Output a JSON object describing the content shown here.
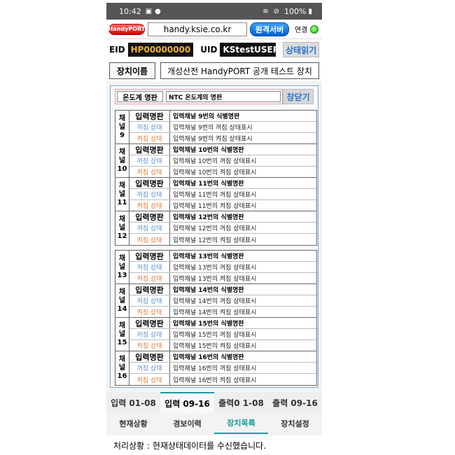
{
  "status_bar": {
    "time": "10:42",
    "battery": "100%",
    "icons": [
      "gallery-icon",
      "location-icon",
      "wifi-icon",
      "do-not-disturb-icon",
      "battery-icon"
    ]
  },
  "appbar": {
    "logo": "HandyPORT",
    "url": "handy.ksie.co.kr",
    "remote_label": "원격서버",
    "connection_label": "연결",
    "connection_color": "#1fb51f"
  },
  "ids": {
    "eid_label": "EID",
    "eid_value": "HP00000000",
    "uid_label": "UID",
    "uid_value": "KStestUSER",
    "read_button": "상태읽기"
  },
  "device": {
    "label": "장치이름",
    "name": "개성산전 HandyPORT 공개 테스트 장치"
  },
  "thermometer": {
    "label": "온도계 명판",
    "value": "NTC 온도계의 명판",
    "close_button": "창닫기"
  },
  "row_labels": {
    "head": "입력명판",
    "off": "꺼짐 상태",
    "on": "켜짐 상태"
  },
  "channels": [
    {
      "c1": "채",
      "c2": "널",
      "num": "9",
      "name": "입력채널 9번의 식별명판",
      "off": "입력채널 9번의 꺼짐 상태표시",
      "on": "입력채널 9번의 켜짐 상태표시"
    },
    {
      "c1": "채",
      "c2": "널",
      "num": "10",
      "name": "입력채널 10번의 식별명판",
      "off": "입력채널 10번의 꺼짐 상태표시",
      "on": "입력채널 10번의 켜짐 상태표시"
    },
    {
      "c1": "채",
      "c2": "널",
      "num": "11",
      "name": "입력채널 11번의 식별명판",
      "off": "입력채널 11번의 꺼짐 상태표시",
      "on": "입력채널 11번의 켜짐 상태표시"
    },
    {
      "c1": "채",
      "c2": "널",
      "num": "12",
      "name": "입력채널 12번의 식별명판",
      "off": "입력채널 12번의 꺼짐 상태표시",
      "on": "입력채널 12번의 켜짐 상태표시"
    },
    {
      "c1": "채",
      "c2": "널",
      "num": "13",
      "name": "입력채널 13번의 식별명판",
      "off": "입력채널 13번의 꺼짐 상태표시",
      "on": "입력채널 13번의 켜짐 상태표시"
    },
    {
      "c1": "채",
      "c2": "널",
      "num": "14",
      "name": "입력채널 14번의 식별명판",
      "off": "입력채널 14번의 꺼짐 상태표시",
      "on": "입력채널 14번의 켜짐 상태표시"
    },
    {
      "c1": "채",
      "c2": "널",
      "num": "15",
      "name": "입력채널 15번의 식별명판",
      "off": "입력채널 15번의 꺼짐 상태표시",
      "on": "입력채널 15번의 켜짐 상태표시"
    },
    {
      "c1": "채",
      "c2": "널",
      "num": "16",
      "name": "입력채널 16번의 식별명판",
      "off": "입력채널 16번의 꺼짐 상태표시",
      "on": "입력채널 16번의 켜짐 상태표시"
    }
  ],
  "io_tabs": [
    "입력 01-08",
    "입력 09-16",
    "출력0 1-08",
    "출력 09-16"
  ],
  "nav_tabs": [
    "현재상황",
    "경보이력",
    "장치목록",
    "장치설정"
  ],
  "status_message": "처리상황 : 현재상태데이터를 수신했습니다.",
  "colors": {
    "accent": "#1a9aa0",
    "link_blue": "#2a74d0",
    "off_blue": "#5b8fd6",
    "on_orange": "#e07a3a"
  }
}
